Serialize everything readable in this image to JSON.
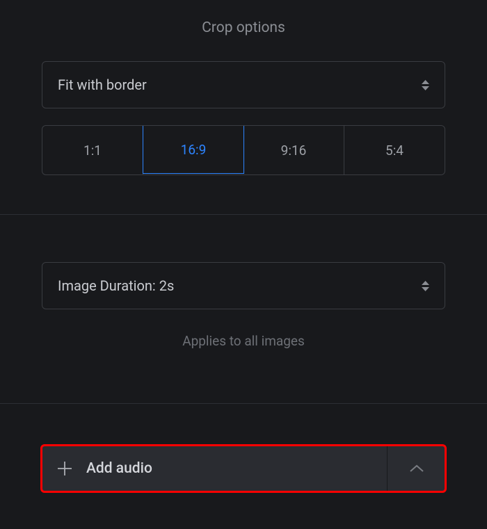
{
  "crop": {
    "heading": "Crop options",
    "fit_label": "Fit with border",
    "ratios": [
      "1:1",
      "16:9",
      "9:16",
      "5:4"
    ],
    "active_ratio_index": 1
  },
  "duration": {
    "label": "Image Duration: 2s",
    "hint": "Applies to all images"
  },
  "audio": {
    "label": "Add audio"
  }
}
